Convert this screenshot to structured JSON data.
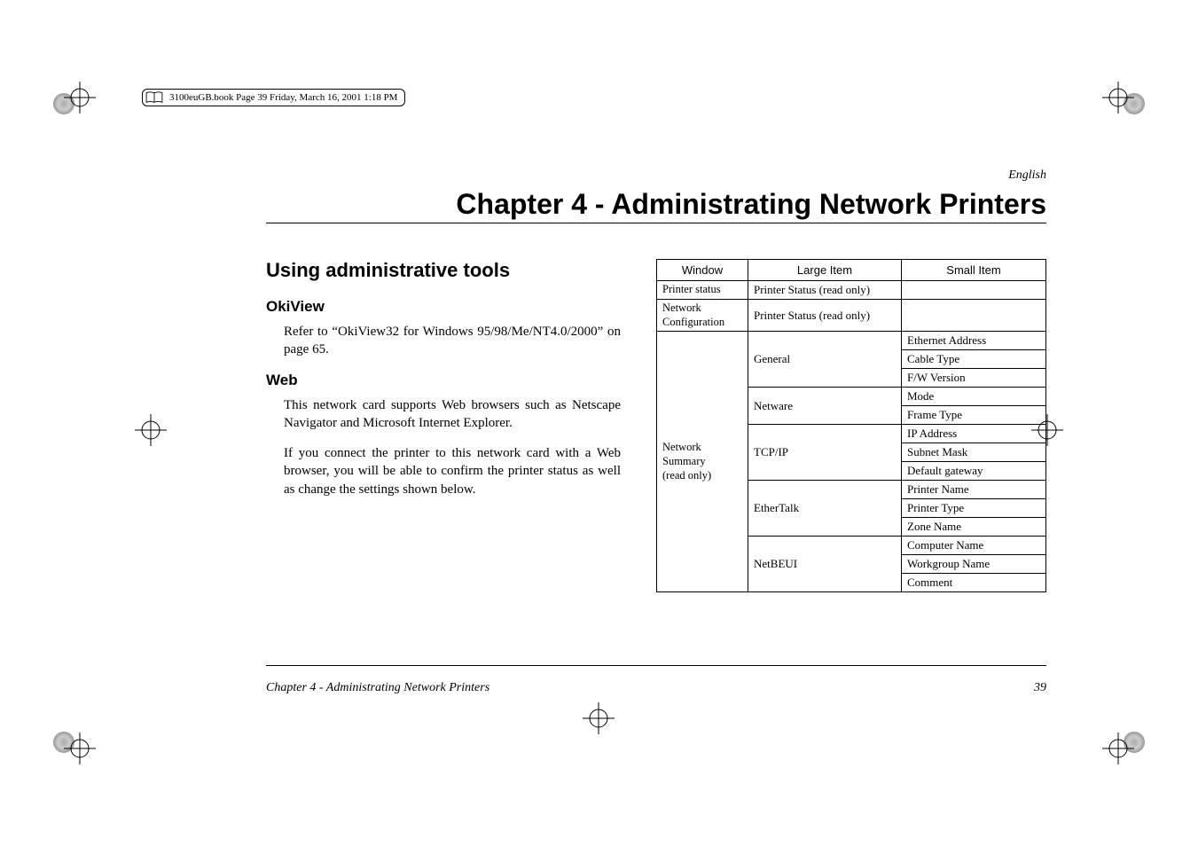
{
  "meta": {
    "book_header": "3100euGB.book  Page 39  Friday, March 16, 2001  1:18 PM",
    "language": "English"
  },
  "chapter": {
    "title": "Chapter 4 - Administrating Network Printers"
  },
  "section": {
    "heading": "Using administrative tools",
    "okiview": {
      "heading": "OkiView",
      "text": "Refer to “OkiView32 for Windows 95/98/Me/NT4.0/2000” on page 65."
    },
    "web": {
      "heading": "Web",
      "p1": "This network card supports Web browsers such as Netscape Navigator and Microsoft Internet Explorer.",
      "p2": "If you connect the printer to this network card with a Web browser, you will be able to confirm the printer status as well as change the settings shown below."
    }
  },
  "table": {
    "headers": {
      "window": "Window",
      "large": "Large Item",
      "small": "Small Item"
    },
    "rows": {
      "printer_status_win": "Printer status",
      "printer_status_large": "Printer Status (read only)",
      "netconf_win_l1": "Network",
      "netconf_win_l2": "Configuration",
      "netconf_large": "Printer Status (read only)",
      "netsum_win_l1": "Network",
      "netsum_win_l2": "Summary",
      "netsum_win_l3": "(read only)",
      "general": "General",
      "ethernet_address": "Ethernet Address",
      "cable_type": "Cable Type",
      "fw_version": "F/W Version",
      "netware": "Netware",
      "mode": "Mode",
      "frame_type": "Frame Type",
      "tcpip": "TCP/IP",
      "ip_address": "IP Address",
      "subnet_mask": "Subnet Mask",
      "default_gateway": "Default gateway",
      "ethertalk": "EtherTalk",
      "printer_name": "Printer Name",
      "printer_type": "Printer Type",
      "zone_name": "Zone Name",
      "netbeui": "NetBEUI",
      "computer_name": "Computer Name",
      "workgroup_name": "Workgroup Name",
      "comment": "Comment"
    }
  },
  "footer": {
    "left": "Chapter 4 - Administrating Network Printers",
    "right": "39"
  }
}
